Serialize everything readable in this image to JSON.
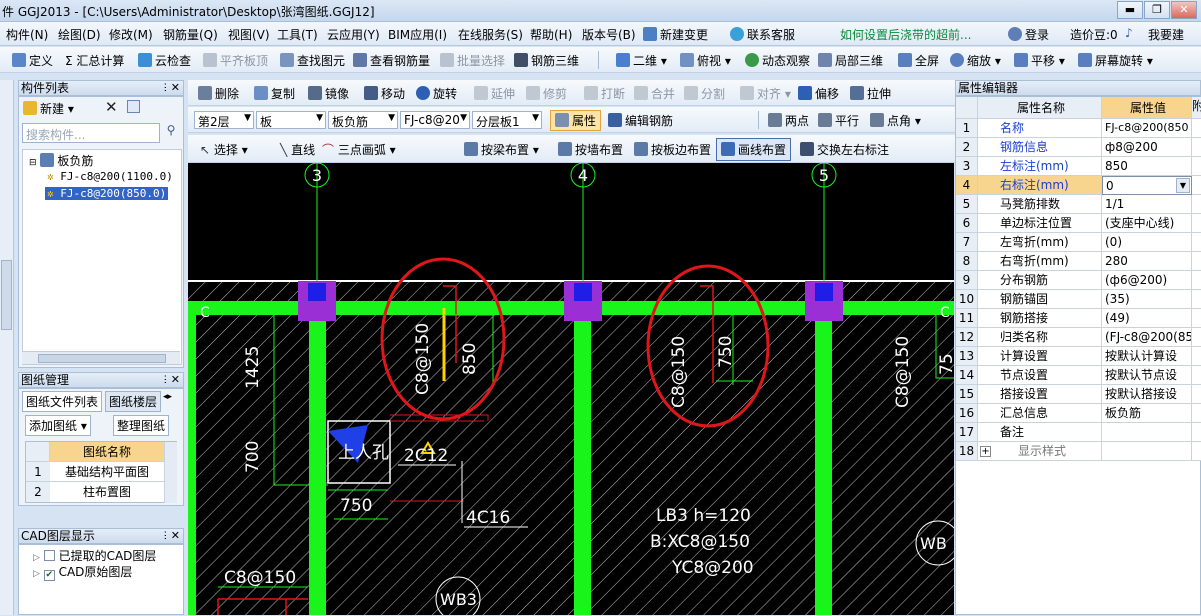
{
  "window": {
    "title": "件 GGJ2013 - [C:\\Users\\Administrator\\Desktop\\张湾图纸.GGJ12]",
    "min": "▬",
    "max": "❐",
    "close": "✕"
  },
  "menu": [
    "构件(N)",
    "绘图(D)",
    "修改(M)",
    "钢筋量(Q)",
    "视图(V)",
    "工具(T)",
    "云应用(Y)",
    "BIM应用(I)",
    "在线服务(S)",
    "帮助(H)",
    "版本号(B)",
    "新建变更",
    "联系客服"
  ],
  "menu_right": {
    "notice": "如何设置后浇带的超前...",
    "login": "登录",
    "coins": "造价豆:0",
    "want": "我要建"
  },
  "toolbar1": [
    "定义",
    "Σ 汇总计算",
    "云检查",
    "平齐板顶",
    "查找图元",
    "查看钢筋量",
    "批量选择",
    "钢筋三维",
    "二维",
    "俯视",
    "动态观察",
    "局部三维",
    "全屏",
    "缩放",
    "平移",
    "屏幕旋转"
  ],
  "toolbar2": [
    "删除",
    "复制",
    "镜像",
    "移动",
    "旋转",
    "延伸",
    "修剪",
    "打断",
    "合并",
    "分割",
    "对齐",
    "偏移",
    "拉伸"
  ],
  "toolbar3": {
    "combos": [
      "第2层",
      "板",
      "板负筋",
      "FJ-c8@20",
      "分层板1"
    ],
    "buttons": [
      "属性",
      "编辑钢筋",
      "两点",
      "平行",
      "点角"
    ]
  },
  "toolbar4": [
    "选择",
    "直线",
    "三点画弧",
    "按梁布置",
    "按墙布置",
    "按板边布置",
    "画线布置",
    "交换左右标注"
  ],
  "component_list": {
    "title": "构件列表",
    "new_label": "新建",
    "search_placeholder": "搜索构件...",
    "tree_root": "板负筋",
    "items": [
      "FJ-c8@200(1100.0)",
      "FJ-c8@200(850.0)"
    ]
  },
  "drawing_mgmt": {
    "title": "图纸管理",
    "tabs": [
      "图纸文件列表",
      "图纸楼层"
    ],
    "buttons": [
      "添加图纸",
      "整理图纸"
    ],
    "header": "图纸名称",
    "rows": [
      {
        "n": "1",
        "name": "基础结构平面图"
      },
      {
        "n": "2",
        "name": "柱布置图"
      }
    ]
  },
  "cad_layers": {
    "title": "CAD图层显示",
    "items": [
      "已提取的CAD图层",
      "CAD原始图层"
    ]
  },
  "prop_editor": {
    "title": "属性编辑器",
    "headers": [
      "属性名称",
      "属性值",
      "附"
    ],
    "rows": [
      {
        "n": "1",
        "name": "名称",
        "value": "FJ-c8@200(850",
        "blue": true
      },
      {
        "n": "2",
        "name": "钢筋信息",
        "value": "ф8@200",
        "blue": true
      },
      {
        "n": "3",
        "name": "左标注(mm)",
        "value": "850",
        "blue": true
      },
      {
        "n": "4",
        "name": "右标注(mm)",
        "value": "0",
        "blue": true
      },
      {
        "n": "5",
        "name": "马凳筋排数",
        "value": "1/1",
        "blue": false
      },
      {
        "n": "6",
        "name": "单边标注位置",
        "value": "(支座中心线)",
        "blue": false
      },
      {
        "n": "7",
        "name": "左弯折(mm)",
        "value": "(0)",
        "blue": false
      },
      {
        "n": "8",
        "name": "右弯折(mm)",
        "value": "280",
        "blue": false
      },
      {
        "n": "9",
        "name": "分布钢筋",
        "value": "(ф6@200)",
        "blue": false
      },
      {
        "n": "10",
        "name": "钢筋锚固",
        "value": "(35)",
        "blue": false
      },
      {
        "n": "11",
        "name": "钢筋搭接",
        "value": "(49)",
        "blue": false
      },
      {
        "n": "12",
        "name": "归类名称",
        "value": "(FJ-c8@200(85",
        "blue": false
      },
      {
        "n": "13",
        "name": "计算设置",
        "value": "按默认计算设",
        "blue": false
      },
      {
        "n": "14",
        "name": "节点设置",
        "value": "按默认节点设",
        "blue": false
      },
      {
        "n": "15",
        "name": "搭接设置",
        "value": "按默认搭接设",
        "blue": false
      },
      {
        "n": "16",
        "name": "汇总信息",
        "value": "板负筋",
        "blue": false
      },
      {
        "n": "17",
        "name": "备注",
        "value": "",
        "blue": false
      },
      {
        "n": "18",
        "name": "显示样式",
        "value": "",
        "blue": false
      }
    ]
  },
  "cad": {
    "axis_labels": [
      "3",
      "4",
      "5"
    ],
    "edge_labels": [
      "C",
      "C"
    ],
    "rebar_labels": [
      "C8@150",
      "C8@150",
      "C8@150",
      "C8@150",
      "75"
    ],
    "dims": [
      "850",
      "750",
      "1425",
      "700",
      "750",
      "75"
    ],
    "hole_label": "上人孔",
    "rebar_2c12": "2C12",
    "rebar_4c16": "4C16",
    "slab_lines": [
      "LB3 h=120",
      "B:XC8@150",
      "YC8@200"
    ],
    "wb_labels": [
      "WB3",
      "WB"
    ]
  },
  "colors": {
    "accent_red": "#e0161b",
    "beam_green": "#19f51a",
    "column_purple": "#9b2fd6"
  }
}
